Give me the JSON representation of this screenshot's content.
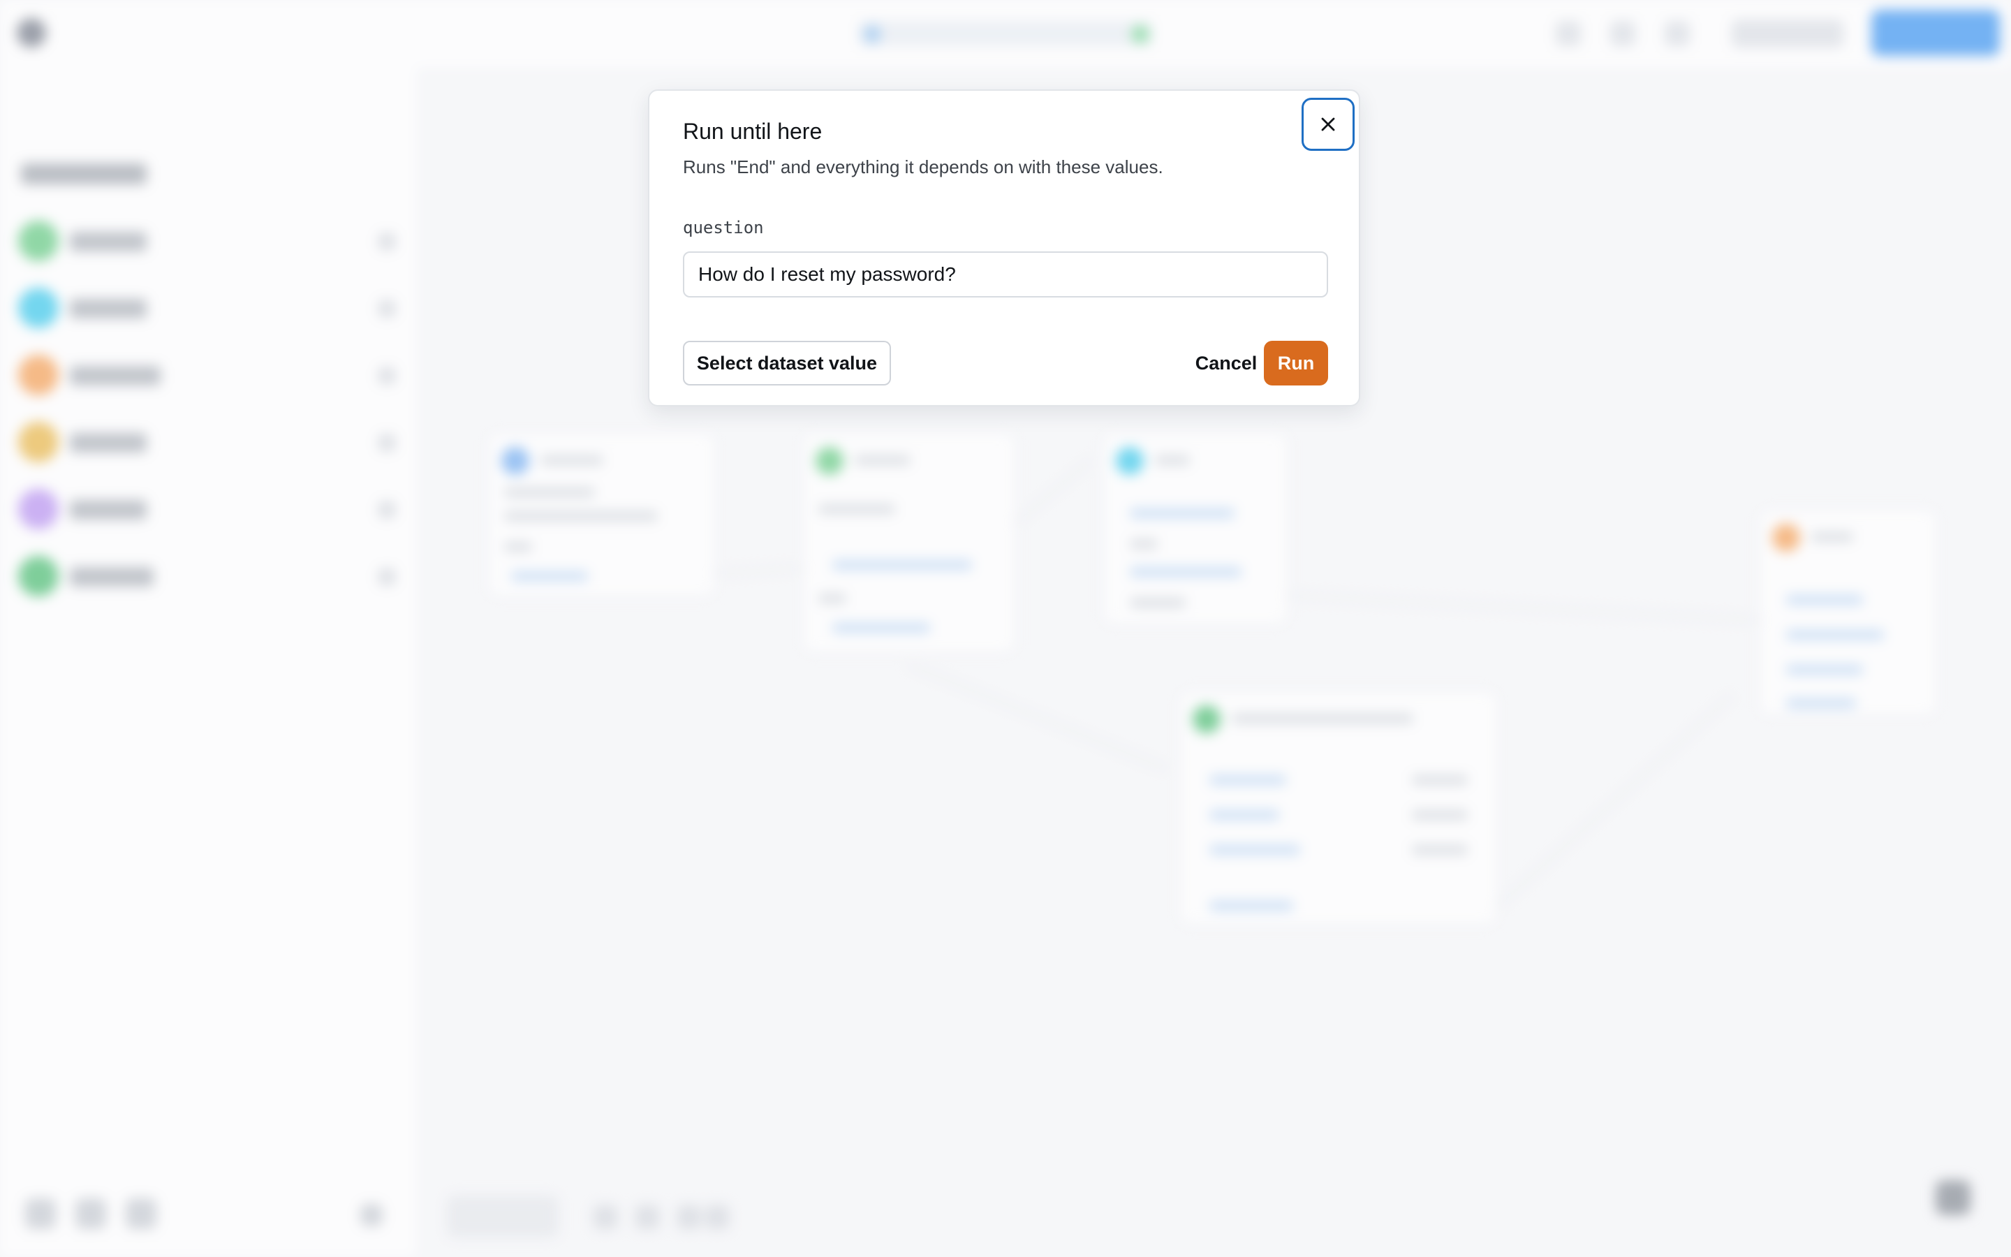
{
  "dialog": {
    "title": "Run until here",
    "description": "Runs \"End\" and everything it depends on with these values.",
    "field_label": "question",
    "field_value": "How do I reset my password?",
    "select_dataset_label": "Select dataset value",
    "cancel_label": "Cancel",
    "run_label": "Run",
    "close_icon": "close-icon"
  },
  "colors": {
    "run_button": "#d96b1e",
    "close_focus_ring": "#1f6fc4",
    "primary_blue": "#2f8ef0",
    "component_green": "#5ac77a",
    "component_cyan": "#2ec5ea",
    "component_orange": "#f59a4a",
    "component_amber": "#e8b23c",
    "component_purple": "#b48cf0",
    "component_green_2": "#3fb968",
    "node_blue": "#6aa8f0"
  }
}
